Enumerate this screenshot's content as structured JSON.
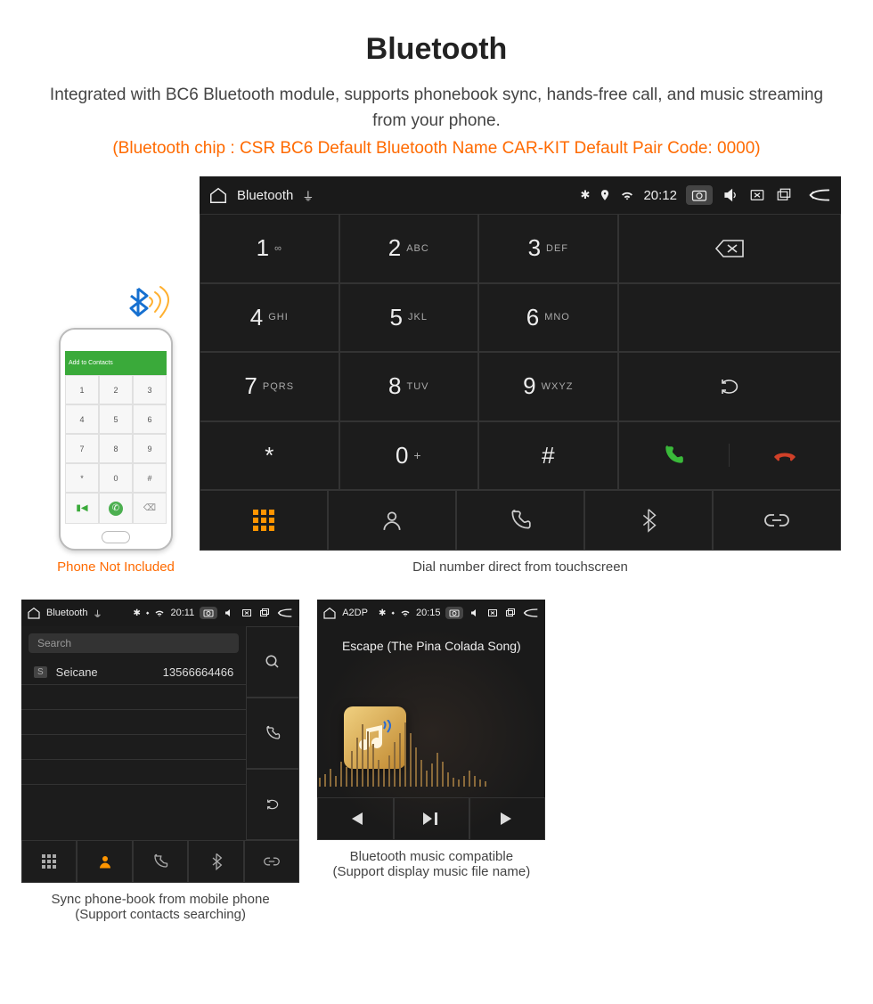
{
  "header": {
    "title": "Bluetooth",
    "subtitle": "Integrated with BC6 Bluetooth module, supports phonebook sync, hands-free call, and music streaming from your phone.",
    "spec": "(Bluetooth chip : CSR BC6    Default Bluetooth Name CAR-KIT    Default Pair Code: 0000)"
  },
  "phone": {
    "banner": "Add to Contacts",
    "keys": [
      "1",
      "2",
      "3",
      "4",
      "5",
      "6",
      "7",
      "8",
      "9",
      "*",
      "0",
      "#"
    ],
    "caption": "Phone Not Included"
  },
  "dialer": {
    "statusbar": {
      "title": "Bluetooth",
      "time": "20:12"
    },
    "keys": [
      {
        "digit": "1",
        "letters": "∞",
        "pos": 0
      },
      {
        "digit": "2",
        "letters": "ABC",
        "pos": 1
      },
      {
        "digit": "3",
        "letters": "DEF",
        "pos": 2
      },
      {
        "digit": "4",
        "letters": "GHI",
        "pos": 4
      },
      {
        "digit": "5",
        "letters": "JKL",
        "pos": 5
      },
      {
        "digit": "6",
        "letters": "MNO",
        "pos": 6
      },
      {
        "digit": "7",
        "letters": "PQRS",
        "pos": 8
      },
      {
        "digit": "8",
        "letters": "TUV",
        "pos": 9
      },
      {
        "digit": "9",
        "letters": "WXYZ",
        "pos": 10
      },
      {
        "digit": "*",
        "letters": "",
        "pos": 12
      },
      {
        "digit": "0",
        "letters": "+",
        "pos": 13,
        "plus": true
      },
      {
        "digit": "#",
        "letters": "",
        "pos": 14
      }
    ],
    "caption": "Dial number direct from touchscreen"
  },
  "phonebook": {
    "statusbar": {
      "title": "Bluetooth",
      "time": "20:11"
    },
    "search_placeholder": "Search",
    "contacts": [
      {
        "badge": "S",
        "name": "Seicane",
        "number": "13566664466"
      }
    ],
    "caption1": "Sync phone-book from mobile phone",
    "caption2": "(Support contacts searching)"
  },
  "music": {
    "statusbar": {
      "title": "A2DP",
      "time": "20:15"
    },
    "song": "Escape (The Pina Colada Song)",
    "caption1": "Bluetooth music compatible",
    "caption2": "(Support display music file name)"
  },
  "colors": {
    "accent": "#ff9500",
    "orange_text": "#ff6a00",
    "green": "#3aaa3a",
    "hangup": "#d04028"
  }
}
